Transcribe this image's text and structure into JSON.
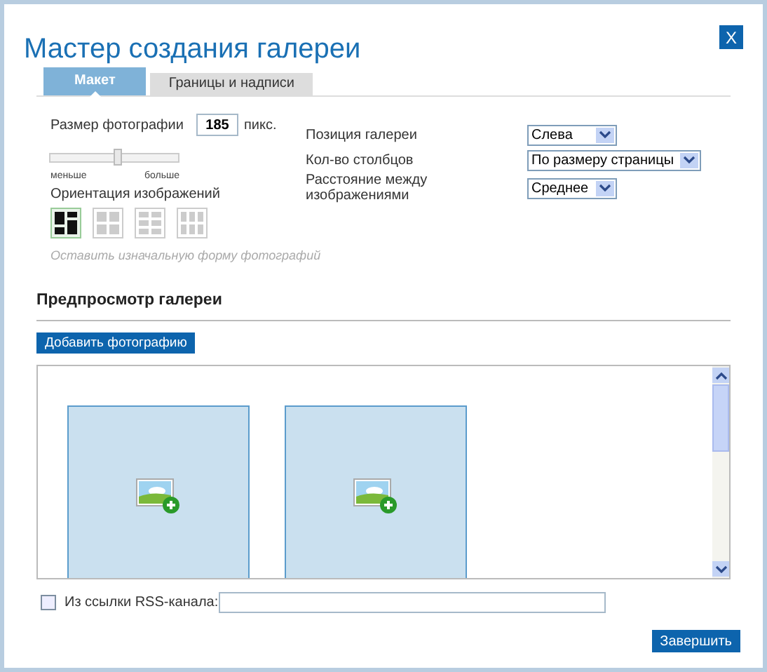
{
  "window": {
    "title": "Мастер создания галереи",
    "close": "X"
  },
  "tabs": [
    {
      "label": "Макет",
      "selected": true
    },
    {
      "label": "Границы и надписи",
      "selected": false
    }
  ],
  "photo_size": {
    "label": "Размер фотографии",
    "value": "185",
    "unit": "пикс.",
    "level": 0.53,
    "min_label": "меньше",
    "max_label": "больше"
  },
  "orientation": {
    "label": "Ориентация изображений",
    "options": [
      {
        "kind": "original",
        "selected": true
      },
      {
        "kind": "grid",
        "selected": false
      },
      {
        "kind": "rows",
        "selected": false
      },
      {
        "kind": "columns",
        "selected": false
      }
    ],
    "hint": "Оставить изначальную форму фотографий"
  },
  "settings": [
    {
      "label": "Позиция галереи",
      "value": "Слева"
    },
    {
      "label": "Кол-во столбцов",
      "value": "По размеру страницы"
    },
    {
      "label": "Расстояние между изображениями",
      "value": "Среднее"
    }
  ],
  "preview": {
    "heading": "Предпросмотр галереи",
    "add_button": "Добавить фотографию",
    "slots": [
      {
        "kind": "empty"
      },
      {
        "kind": "empty"
      }
    ]
  },
  "rss": {
    "label": "Из ссылки RSS-канала:",
    "checked": false
  },
  "finish_button": "Завершить"
}
